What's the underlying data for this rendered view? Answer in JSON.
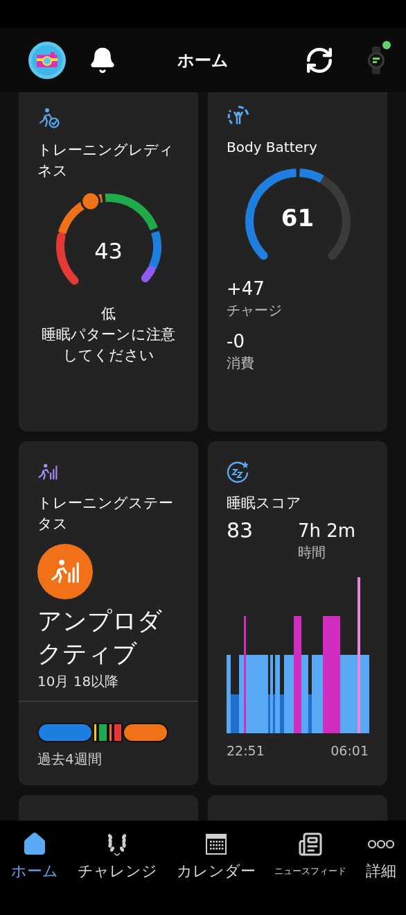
{
  "header": {
    "title": "ホーム"
  },
  "training_readiness": {
    "title": "トレーニングレディネス",
    "score": "43",
    "level_label": "低",
    "message": "睡眠パターンに注意してください"
  },
  "body_battery": {
    "title": "Body Battery",
    "value": "61",
    "charge_value": "+47",
    "charge_label": "チャージ",
    "drain_value": "-0",
    "drain_label": "消費"
  },
  "training_status": {
    "title": "トレーニングステータス",
    "status": "アンプロダクティブ",
    "since": "10月 18以降",
    "period_label": "過去4週間"
  },
  "sleep_score": {
    "title": "睡眠スコア",
    "score": "83",
    "duration": "7h 2m",
    "duration_label": "時間",
    "start_time": "22:51",
    "end_time": "06:01"
  },
  "nav": {
    "items": [
      {
        "kind": "home",
        "label": "ホーム",
        "selected": true
      },
      {
        "kind": "challenge",
        "label": "チャレンジ",
        "selected": false
      },
      {
        "kind": "calendar",
        "label": "カレンダー",
        "selected": false
      },
      {
        "kind": "news",
        "label": "ニュースフィード",
        "selected": false
      },
      {
        "kind": "more",
        "label": "詳細",
        "selected": false
      }
    ]
  }
}
